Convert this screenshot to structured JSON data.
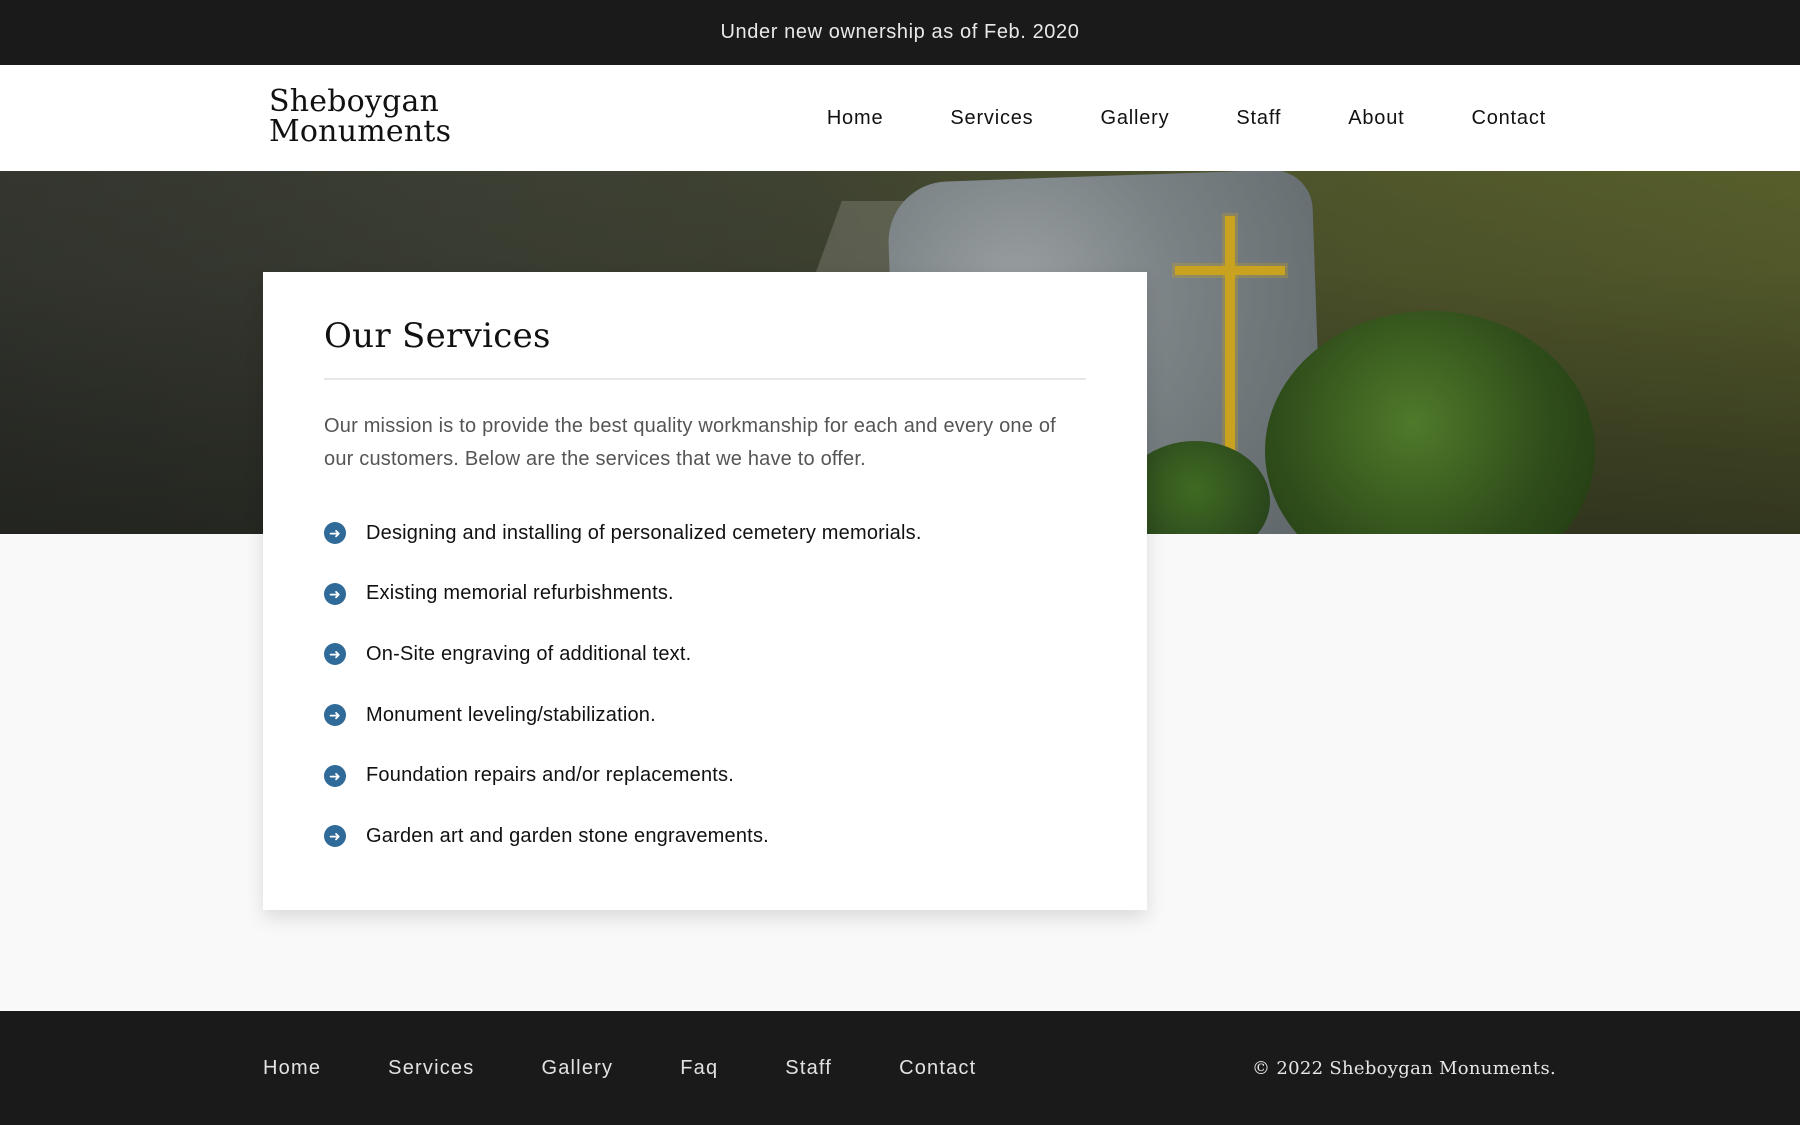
{
  "announcement": "Under new ownership as of Feb. 2020",
  "brand": {
    "line1": "Sheboygan",
    "line2": "Monuments"
  },
  "nav": {
    "items": [
      "Home",
      "Services",
      "Gallery",
      "Staff",
      "About",
      "Contact"
    ]
  },
  "services": {
    "title": "Our Services",
    "intro": "Our mission is to provide the best quality workmanship for each and every one of our customers. Below are the services that we have to offer.",
    "items": [
      "Designing and installing of personalized cemetery memorials.",
      "Existing memorial refurbishments.",
      "On-Site engraving of additional text.",
      "Monument leveling/stabilization.",
      "Foundation repairs and/or replacements.",
      "Garden art and garden stone engravements."
    ],
    "bullet_icon": "arrow-circle-right-icon",
    "bullet_glyph": "➜",
    "accent_color": "#2f6a98"
  },
  "footer": {
    "nav": [
      "Home",
      "Services",
      "Gallery",
      "Faq",
      "Staff",
      "Contact"
    ],
    "copyright": "© 2022 Sheboygan Monuments."
  },
  "hero": {
    "image": "cemetery-headstone-with-cross-and-praying-hands"
  }
}
